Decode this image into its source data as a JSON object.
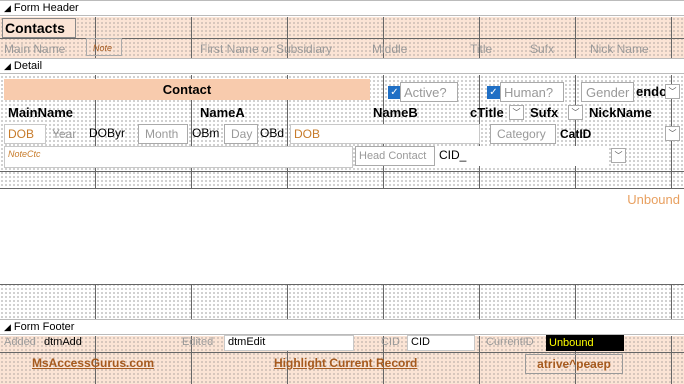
{
  "sections": {
    "header": "Form Header",
    "detail": "Detail",
    "footer": "Form Footer"
  },
  "header": {
    "title": "Contacts",
    "labels": {
      "main_name": "Main Name",
      "note": "Note",
      "first_name": "First Name or Subsidiary",
      "middle": "Middle",
      "title": "Title",
      "sufx": "Sufx",
      "nick_name": "Nick Name"
    }
  },
  "detail": {
    "contact_banner": "Contact",
    "active_label": "Active?",
    "human_label": "Human?",
    "gender_label": "Gender",
    "gender_value": "endo",
    "main_name": "MainName",
    "name_a": "NameA",
    "name_b": "NameB",
    "title_value": "cTitle",
    "sufx_value": "Sufx",
    "nick_name": "NickName",
    "dob_label": "DOB",
    "year_label": "Year",
    "dob_year": "DOByr",
    "month_label": "Month",
    "dob_month": "OBm",
    "day_label": "Day",
    "dob_day": "OBd",
    "dob_field": "DOB",
    "category_label": "Category",
    "category_value": "CatID",
    "note_ctc": "NoteCtc",
    "head_contact_label": "Head Contact",
    "head_contact_value": "CID_",
    "unbound": "Unbound"
  },
  "footer": {
    "added_label": "Added",
    "added_value": "dtmAdd",
    "edited_label": "Edited",
    "edited_value": "dtmEdit",
    "cid_label": "CID",
    "cid_value": "CID",
    "current_id_label": "CurrentID",
    "current_id_value": "Unbound",
    "site_link": "MsAccessGurus.com",
    "highlight_label": "Highlight Current Record",
    "upside_label": "atrive^peaep"
  },
  "colors": {
    "peach": "#fbe4d5",
    "banner": "#f8cbad",
    "accent_text": "#e8a060",
    "check_blue": "#1f6fc5",
    "black_box": "#000000",
    "yellow": "#ffff00"
  }
}
